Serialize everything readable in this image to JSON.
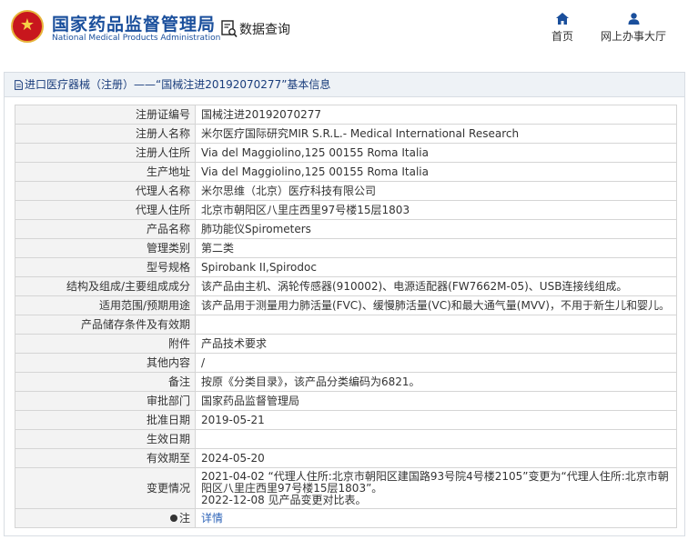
{
  "header": {
    "title": "国家药品监督管理局",
    "subtitle": "National Medical Products Administration",
    "data_query": "数据查询",
    "nav": [
      {
        "label": "首页",
        "icon": "home-icon"
      },
      {
        "label": "网上办事大厅",
        "icon": "user-icon"
      }
    ]
  },
  "breadcrumb": {
    "text": "进口医疗器械（注册）——“国械注进20192070277”基本信息"
  },
  "rows": [
    {
      "label": "注册证编号",
      "value": "国械注进20192070277"
    },
    {
      "label": "注册人名称",
      "value": "米尔医疗国际研究MIR S.R.L.- Medical International Research"
    },
    {
      "label": "注册人住所",
      "value": "Via del Maggiolino,125 00155 Roma Italia"
    },
    {
      "label": "生产地址",
      "value": "Via del Maggiolino,125 00155 Roma Italia"
    },
    {
      "label": "代理人名称",
      "value": "米尔思维（北京）医疗科技有限公司"
    },
    {
      "label": "代理人住所",
      "value": "北京市朝阳区八里庄西里97号楼15层1803"
    },
    {
      "label": "产品名称",
      "value": "肺功能仪Spirometers"
    },
    {
      "label": "管理类别",
      "value": "第二类"
    },
    {
      "label": "型号规格",
      "value": "Spirobank II,Spirodoc"
    },
    {
      "label": "结构及组成/主要组成成分",
      "value": "该产品由主机、涡轮传感器(910002)、电源适配器(FW7662M-05)、USB连接线组成。"
    },
    {
      "label": "适用范围/预期用途",
      "value": "该产品用于测量用力肺活量(FVC)、缓慢肺活量(VC)和最大通气量(MVV)，不用于新生儿和婴儿。"
    },
    {
      "label": "产品储存条件及有效期",
      "value": ""
    },
    {
      "label": "附件",
      "value": "产品技术要求"
    },
    {
      "label": "其他内容",
      "value": "/"
    },
    {
      "label": "备注",
      "value": "按原《分类目录》，该产品分类编码为6821。"
    },
    {
      "label": "审批部门",
      "value": "国家药品监督管理局"
    },
    {
      "label": "批准日期",
      "value": "2019-05-21"
    },
    {
      "label": "生效日期",
      "value": ""
    },
    {
      "label": "有效期至",
      "value": "2024-05-20"
    }
  ],
  "change": {
    "label": "变更情况",
    "line1": "2021-04-02 “代理人住所:北京市朝阳区建国路93号院4号楼2105”变更为“代理人住所:北京市朝阳区八里庄西里97号楼15层1803”。",
    "line2": "2022-12-08 见产品变更对比表。"
  },
  "note": {
    "label": "注",
    "link": "详情"
  },
  "colors": {
    "brand_blue": "#1a4f9c",
    "emblem_red": "#c8161d",
    "link_blue": "#2e64b8"
  }
}
